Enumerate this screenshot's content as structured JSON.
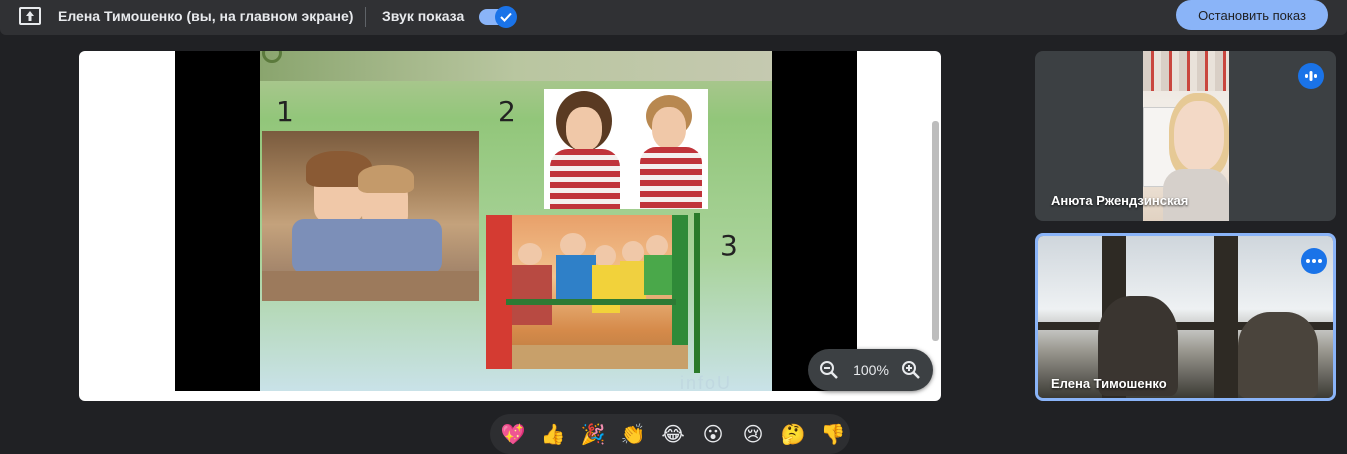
{
  "topbar": {
    "presenter_text": "Елена Тимошенко (вы, на главном экране)",
    "sound_label": "Звук показа",
    "sound_on": true,
    "stop_button": "Остановить показ",
    "share_icon": "present-screen-icon"
  },
  "slide": {
    "labels": [
      "1",
      "2",
      "3"
    ],
    "watermark": "infoU"
  },
  "zoom": {
    "level": "100%",
    "zoom_out_icon": "zoom-out-icon",
    "zoom_in_icon": "zoom-in-icon"
  },
  "participants": [
    {
      "name": "Анюта Ржендзинская",
      "badge": "audio-level-icon"
    },
    {
      "name": "Елена Тимошенко",
      "badge": "more-options-icon"
    }
  ],
  "reactions": [
    "💖",
    "👍",
    "🎉",
    "👏",
    "😂",
    "😮",
    "😢",
    "🤔",
    "👎"
  ],
  "colors": {
    "accent": "#8ab4f8",
    "blue": "#1a73e8",
    "bg": "#202124"
  }
}
